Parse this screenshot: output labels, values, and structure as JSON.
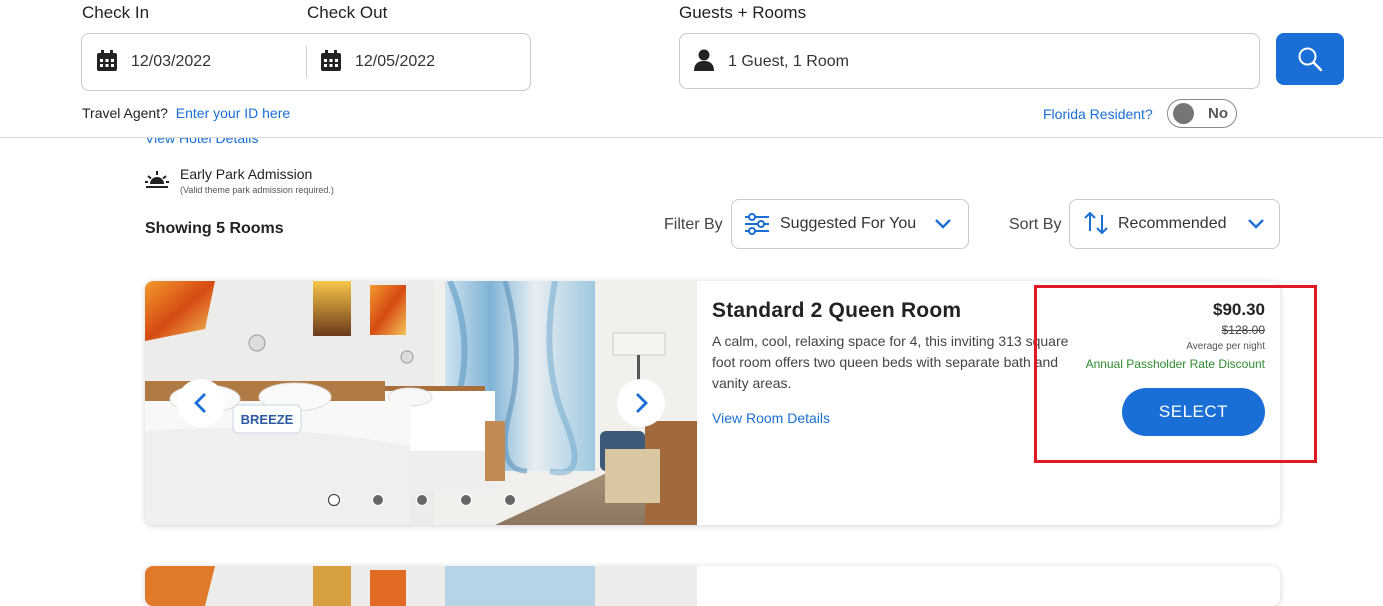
{
  "search": {
    "check_in_label": "Check In",
    "check_in_value": "12/03/2022",
    "check_out_label": "Check Out",
    "check_out_value": "12/05/2022",
    "guests_label": "Guests + Rooms",
    "guests_value": "1 Guest, 1 Room",
    "travel_agent_label": "Travel Agent?",
    "travel_agent_link": "Enter your ID here",
    "florida_resident_label": "Florida Resident?",
    "florida_resident_value": "No"
  },
  "hotel": {
    "view_hotel_details": "View Hotel Details",
    "amenity_title": "Early Park Admission",
    "amenity_note": "(Valid theme park admission required.)"
  },
  "results": {
    "showing": "Showing 5 Rooms",
    "filter_label": "Filter By",
    "filter_value": "Suggested For You",
    "sort_label": "Sort By",
    "sort_value": "Recommended"
  },
  "room": {
    "title": "Standard 2 Queen Room",
    "description": "A calm, cool, relaxing space for 4, this inviting 313 square foot room offers two queen beds with separate bath and vanity areas.",
    "details_link": "View Room Details",
    "price": "$90.30",
    "original_price": "$128.00",
    "price_note": "Average per night",
    "discount": "Annual Passholder Rate Discount",
    "select_label": "SELECT",
    "pillow_text": "BREEZE",
    "carousel_count": 5,
    "carousel_active": 0
  },
  "colors": {
    "accent": "#1a6fd6",
    "discount_green": "#2e8b2e",
    "highlight_red": "#e01a22"
  }
}
